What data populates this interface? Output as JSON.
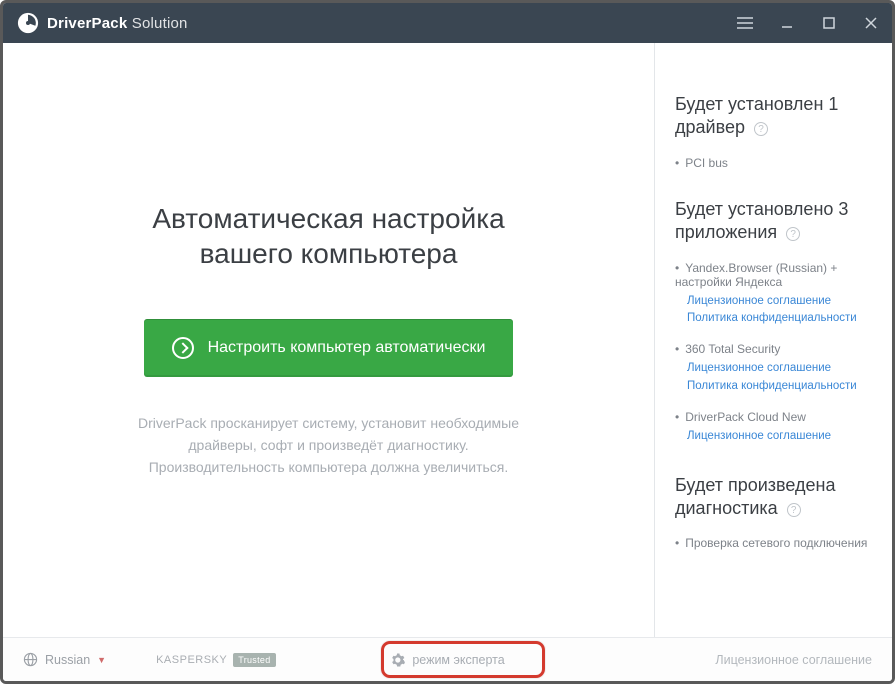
{
  "app": {
    "name_bold": "DriverPack",
    "name_thin": "Solution"
  },
  "main": {
    "headline_l1": "Автоматическая настройка",
    "headline_l2": "вашего компьютера",
    "button": "Настроить компьютер автоматически",
    "sub_l1": "DriverPack просканирует систему, установит необходимые",
    "sub_l2": "драйверы, софт и произведёт диагностику.",
    "sub_l3": "Производительность компьютера должна увеличиться."
  },
  "side": {
    "drivers_title": "Будет установлен 1 драйвер",
    "driver_item": "PCI bus",
    "apps_title": "Будет установлено 3 приложения",
    "app1_name": "Yandex.Browser (Russian) + настройки Яндекса",
    "app1_link1": "Лицензионное соглашение",
    "app1_link2": "Политика конфиденциальности",
    "app2_name": "360 Total Security",
    "app2_link1": "Лицензионное соглашение",
    "app2_link2": "Политика конфиденциальности",
    "app3_name": "DriverPack Cloud New",
    "app3_link1": "Лицензионное соглашение",
    "diag_title": "Будет произведена диагностика",
    "diag_item": "Проверка сетевого подключения"
  },
  "footer": {
    "language": "Russian",
    "kaspersky": "KASPERSKY",
    "kaspersky_badge": "Trusted",
    "expert": "режим эксперта",
    "license": "Лицензионное соглашение"
  }
}
